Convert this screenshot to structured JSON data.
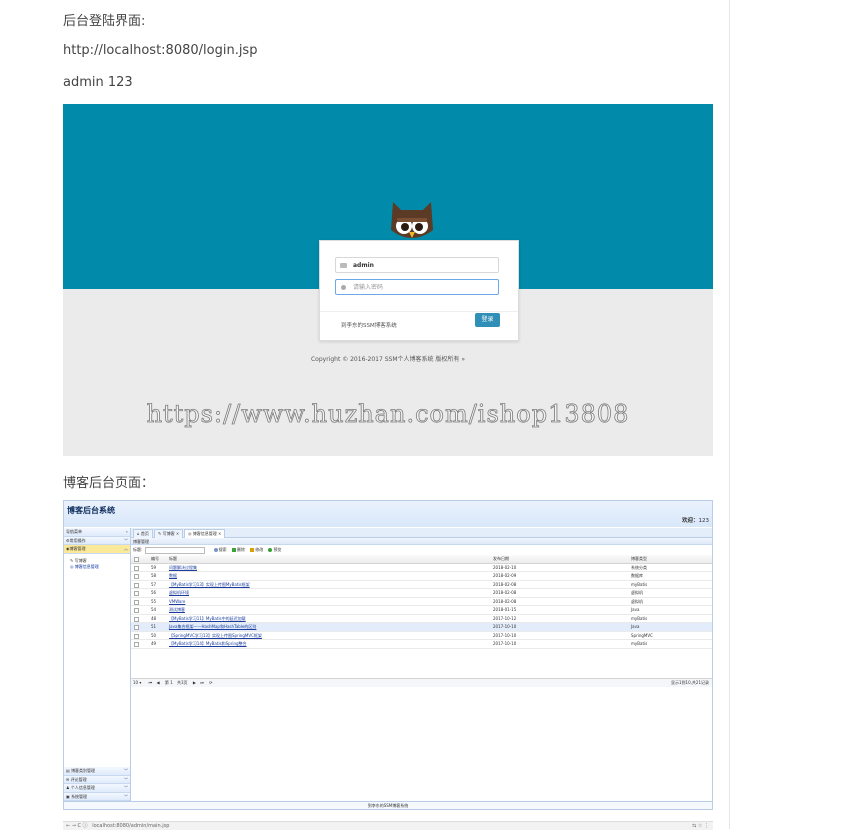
{
  "doc": {
    "heading_login": "后台登陆界面:",
    "login_url": "http://localhost:8080/login.jsp",
    "credentials": "admin 123",
    "heading_admin": "博客后台页面："
  },
  "login": {
    "username_value": "admin",
    "password_placeholder": "请输入密码",
    "register_link": "到李东的SSM博客系统",
    "login_button": "登录",
    "copyright": "Copyright © 2016-2017 SSM个人博客系统 版权所有 »",
    "watermark": "https://www.huzhan.com/ishop13808",
    "colors": {
      "top": "#018aa9",
      "bottom": "#ebebeb",
      "button": "#2f8fb6"
    }
  },
  "admin": {
    "title": "博客后台系统",
    "welcome_label": "欢迎：",
    "welcome_user": "123",
    "sidebar": {
      "top": [
        {
          "label": "导航菜单",
          "icon": "none",
          "active": false
        },
        {
          "label": "常用操作",
          "icon": "gear-icon",
          "active": false
        },
        {
          "label": "博客管理",
          "icon": "doc-icon",
          "active": true
        }
      ],
      "items": [
        {
          "label": "写博客",
          "selected": false
        },
        {
          "label": "博客信息管理",
          "selected": true
        }
      ],
      "bottom": [
        {
          "label": "博客类别管理",
          "icon": "folder-icon"
        },
        {
          "label": "评论管理",
          "icon": "chat-icon"
        },
        {
          "label": "个人信息管理",
          "icon": "user-icon"
        },
        {
          "label": "系统管理",
          "icon": "system-icon"
        }
      ]
    },
    "tabs": [
      {
        "label": "首页",
        "active": false
      },
      {
        "label": "写博客 ×",
        "active": false
      },
      {
        "label": "博客信息管理 ×",
        "active": true
      }
    ],
    "panel_title": "博客管理",
    "toolbar": {
      "search_label": "标题:",
      "search": "搜索",
      "delete": "删除",
      "edit": "修改",
      "preview": "预览"
    },
    "table": {
      "headers": {
        "id": "编号",
        "title": "标题",
        "date": "发布日期",
        "type": "博客类型"
      },
      "rows": [
        {
          "id": "59",
          "title": "问题解决过程集",
          "date": "2018-02-10",
          "type": "系统分类"
        },
        {
          "id": "58",
          "title": "数据",
          "date": "2018-02-09",
          "type": "数据库"
        },
        {
          "id": "57",
          "title": "【MyBatis学习13】实现上传图MyBatis框架",
          "date": "2018-02-08",
          "type": "myBatis"
        },
        {
          "id": "56",
          "title": "虚拟机环境",
          "date": "2018-02-08",
          "type": "虚拟机"
        },
        {
          "id": "55",
          "title": "VMWare",
          "date": "2018-02-08",
          "type": "虚拟机"
        },
        {
          "id": "54",
          "title": "测试博客",
          "date": "2018-01-15",
          "type": "Java"
        },
        {
          "id": "48",
          "title": "【MyBatis学习11】MyBatis中的延迟加载",
          "date": "2017-10-12",
          "type": "myBatis"
        },
        {
          "id": "51",
          "title": "Java集合框架——HashMap和HashTable的区别",
          "date": "2017-10-10",
          "type": "Java"
        },
        {
          "id": "50",
          "title": "【SpringMVC学习13】实现上传图SpringMVC框架",
          "date": "2017-10-10",
          "type": "SpringMVC"
        },
        {
          "id": "49",
          "title": "【MyBatis学习14】MyBatis和Spring整合",
          "date": "2017-10-10",
          "type": "myBatis"
        }
      ]
    },
    "pager": {
      "size": "10",
      "page_label": "第",
      "page": "1",
      "total_label": "共3页",
      "display": "显示1到10,共21记录"
    },
    "footer": "到李东的SSM博客系统"
  },
  "browser": {
    "url": "localhost:8080/admin/main.jsp",
    "buttons": "← → C ⓘ",
    "right": "⇆ ☆ ⋮"
  }
}
